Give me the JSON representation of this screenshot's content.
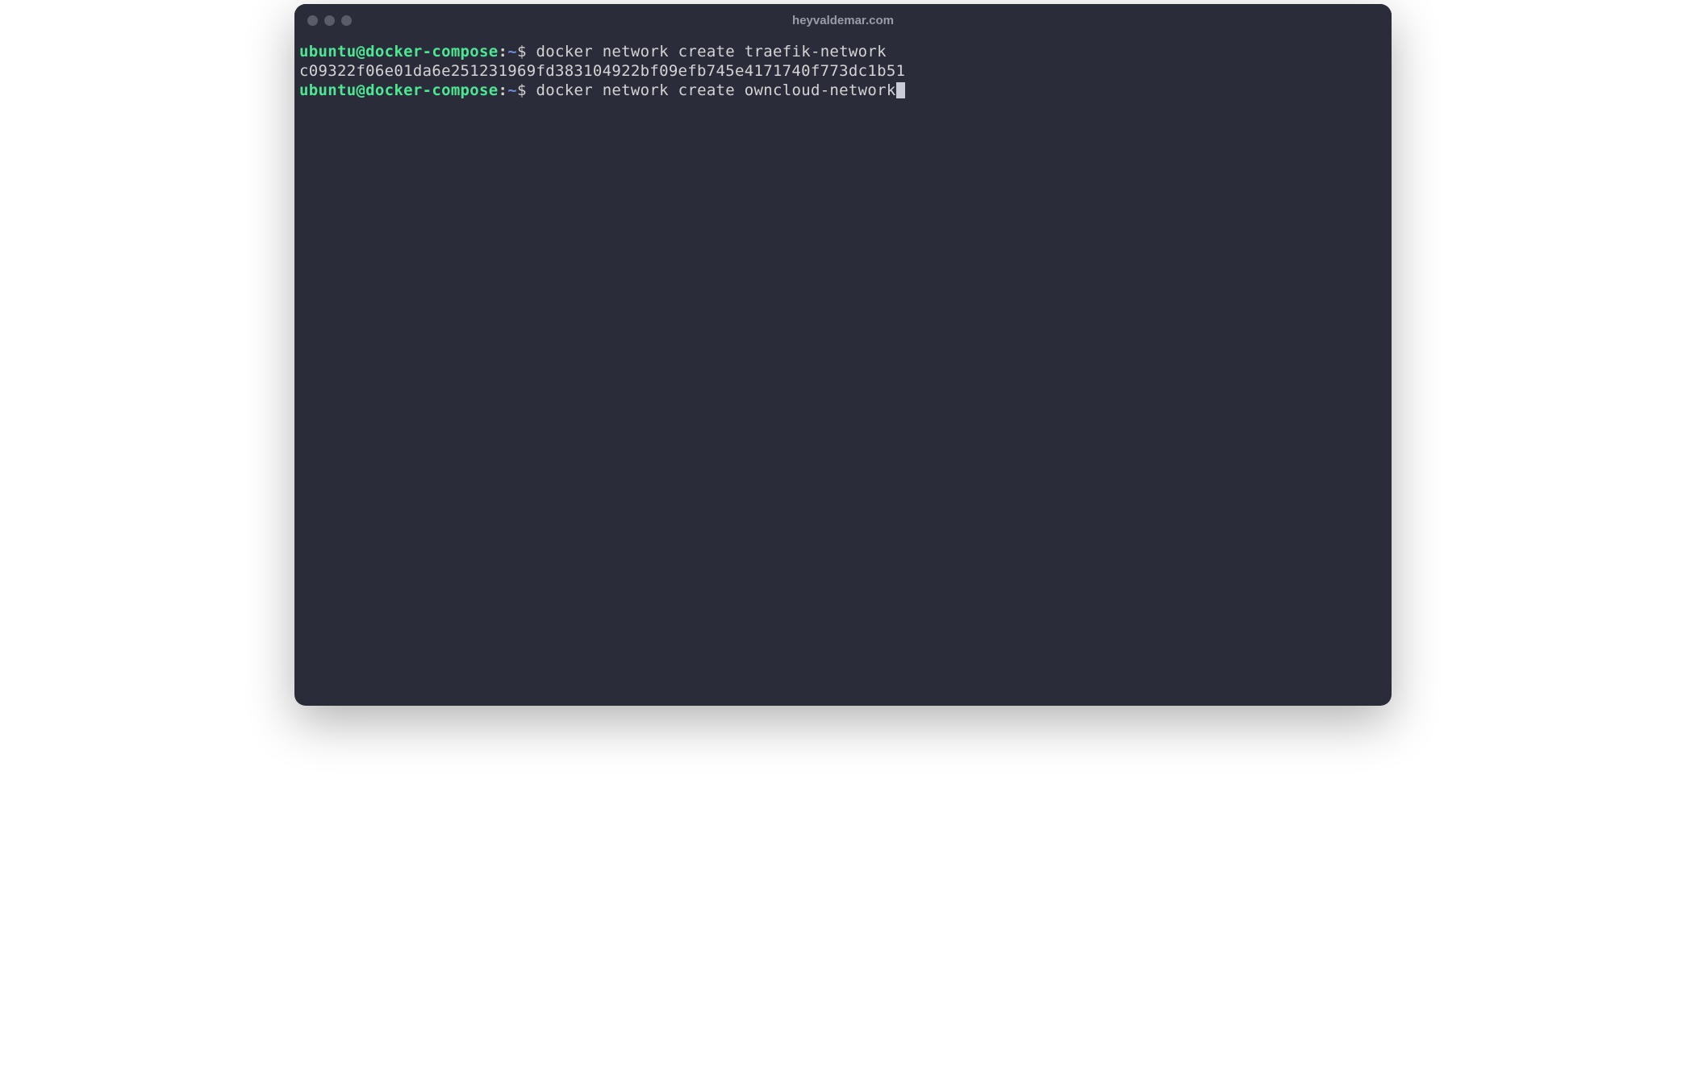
{
  "window": {
    "title": "heyvaldemar.com"
  },
  "prompt": {
    "user_host": "ubuntu@docker-compose",
    "colon": ":",
    "tilde": "~",
    "dollar": "$"
  },
  "lines": [
    {
      "type": "command",
      "text": " docker network create traefik-network"
    },
    {
      "type": "output",
      "text": "c09322f06e01da6e251231969fd383104922bf09efb745e4171740f773dc1b51"
    },
    {
      "type": "command",
      "text": " docker network create owncloud-network",
      "cursor": true
    }
  ]
}
